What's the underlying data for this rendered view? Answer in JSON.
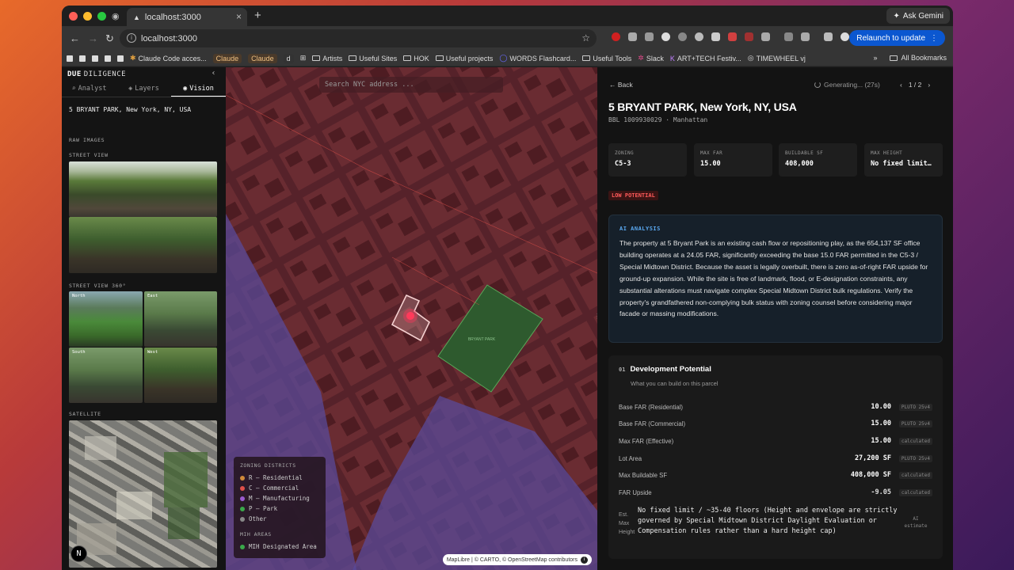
{
  "browser": {
    "tab_title": "localhost:3000",
    "url": "localhost:3000",
    "ask_gemini": "Ask Gemini",
    "relaunch": "Relaunch to update",
    "bookmarks": [
      "Claude Code acces...",
      "Claude",
      "Claude",
      "d",
      "Artists",
      "Useful Sites",
      "HOK",
      "Useful projects",
      "WORDS Flashcard...",
      "Useful Tools",
      "Slack",
      "ART+TECH Festiv...",
      "TIMEWHEEL vj"
    ],
    "all_bookmarks": "All Bookmarks",
    "overflow": "»"
  },
  "left_panel": {
    "brand_bold": "DUE",
    "brand_rest": "DILIGENCE",
    "collapse": "‹",
    "tabs": [
      {
        "icon": "⌕",
        "label": "Analyst"
      },
      {
        "icon": "◈",
        "label": "Layers"
      },
      {
        "icon": "◉",
        "label": "Vision"
      }
    ],
    "address": "5 BRYANT PARK, New York, NY, USA",
    "raw_images": "RAW IMAGES",
    "street_view": "STREET VIEW",
    "street_view_360": "STREET VIEW 360°",
    "directions": [
      "North",
      "East",
      "South",
      "West"
    ],
    "satellite": "SATELLITE",
    "n_badge": "N"
  },
  "map": {
    "search_placeholder": "Search NYC address ...",
    "legend_title": "ZONING DISTRICTS",
    "legend": [
      {
        "label": "R — Residential",
        "color": "#d08a3a"
      },
      {
        "label": "C — Commercial",
        "color": "#e0504a"
      },
      {
        "label": "M — Manufacturing",
        "color": "#9a5ad0"
      },
      {
        "label": "P — Park",
        "color": "#3aa84a"
      },
      {
        "label": "Other",
        "color": "#888888"
      }
    ],
    "mih_title": "MIH AREAS",
    "mih_label": "MIH Designated Area",
    "mih_color": "#3aa84a",
    "park_label": "BRYANT PARK",
    "attribution": "MapLibre | © CARTO, © OpenStreetMap contributors"
  },
  "right_panel": {
    "back": "Back",
    "generating": "Generating... (27s)",
    "pager": "1 / 2",
    "title": "5 BRYANT PARK, New York, NY, USA",
    "bbl": "BBL 1009930029 · Manhattan",
    "stats": [
      {
        "label": "ZONING",
        "value": "C5-3"
      },
      {
        "label": "MAX FAR",
        "value": "15.00"
      },
      {
        "label": "BUILDABLE SF",
        "value": "408,000"
      },
      {
        "label": "MAX HEIGHT",
        "value": "No fixed limit…"
      }
    ],
    "potential_badge": "LOW POTENTIAL",
    "ai_title": "AI ANALYSIS",
    "ai_text": "The property at 5 Bryant Park is an existing cash flow or repositioning play, as the 654,137 SF office building operates at a 24.05 FAR, significantly exceeding the base 15.0 FAR permitted in the C5-3 / Special Midtown District. Because the asset is legally overbuilt, there is zero as-of-right FAR upside for ground-up expansion. While the site is free of landmark, flood, or E-designation constraints, any substantial alterations must navigate complex Special Midtown District bulk regulations. Verify the property's grandfathered non-complying bulk status with zoning counsel before considering major facade or massing modifications.",
    "dev_num": "01",
    "dev_title": "Development Potential",
    "dev_sub": "What you can build on this parcel",
    "rows": [
      {
        "label": "Base FAR (Residential)",
        "value": "10.00",
        "source": "PLUTO 25v4"
      },
      {
        "label": "Base FAR (Commercial)",
        "value": "15.00",
        "source": "PLUTO 25v4"
      },
      {
        "label": "Max FAR (Effective)",
        "value": "15.00",
        "source": "calculated"
      },
      {
        "label": "Lot Area",
        "value": "27,200 SF",
        "source": "PLUTO 25v4"
      },
      {
        "label": "Max Buildable SF",
        "value": "408,000 SF",
        "source": "calculated"
      },
      {
        "label": "FAR Upside",
        "value": "-9.05",
        "source": "calculated"
      }
    ],
    "height_label": "Est. Max Height",
    "height_value": "No fixed limit / ~35-40 floors (Height and envelope are strictly governed by Special Midtown District Daylight Evaluation or Compensation rules rather than a hard height cap)",
    "height_source": "AI estimate"
  }
}
